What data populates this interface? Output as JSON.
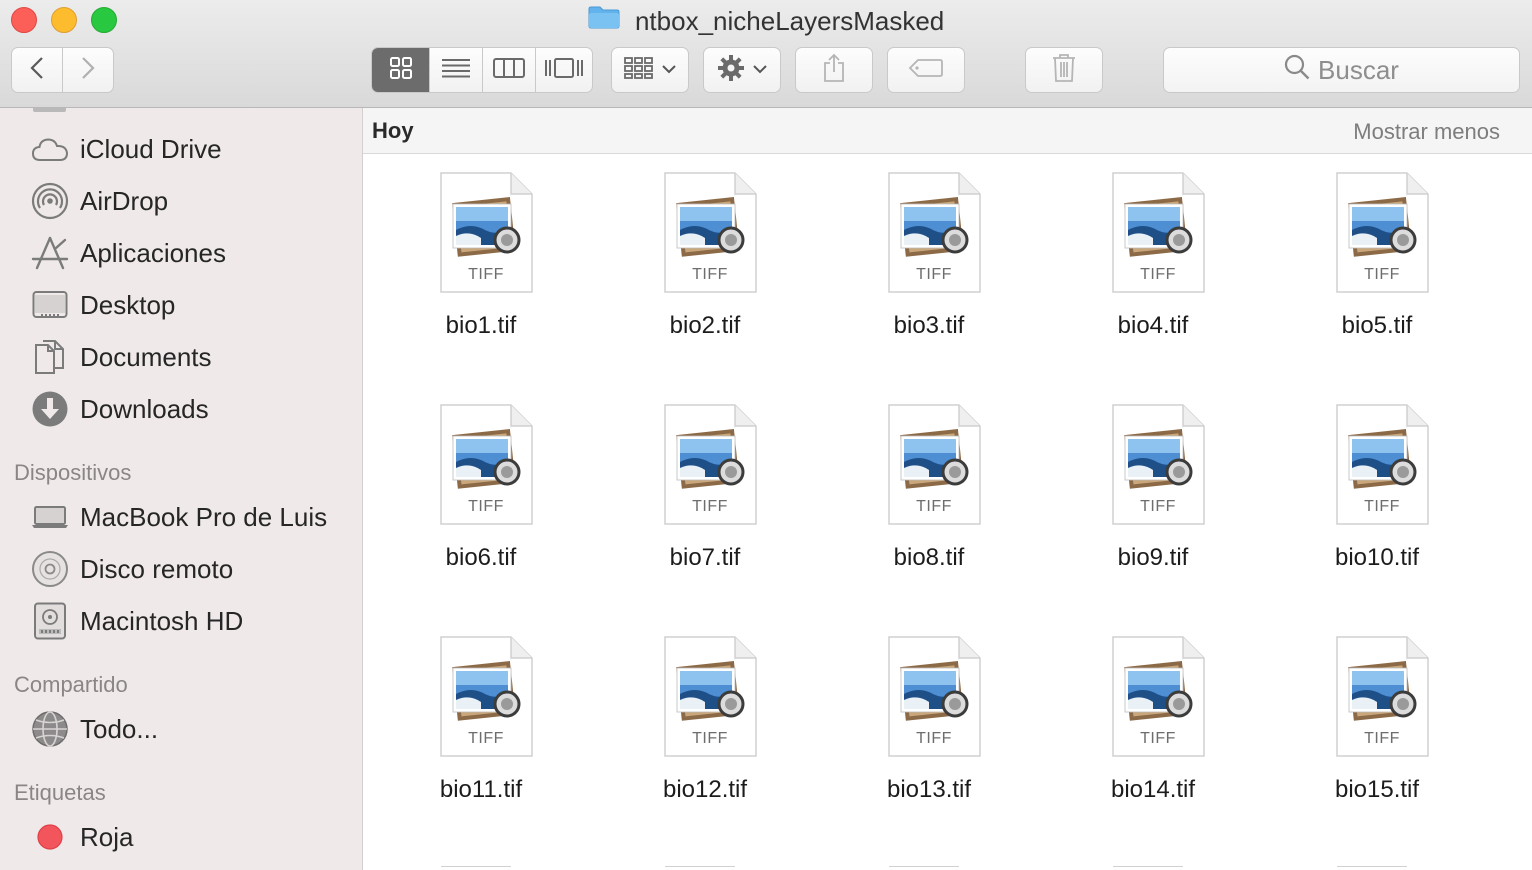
{
  "window": {
    "title": "ntbox_nicheLayersMasked"
  },
  "toolbar": {
    "search_placeholder": "Buscar",
    "icons": [
      "back-icon",
      "forward-icon",
      "icon-view-icon",
      "list-view-icon",
      "column-view-icon",
      "cover-flow-icon",
      "arrange-icon",
      "gear-icon",
      "share-icon",
      "tag-icon",
      "trash-icon",
      "search-icon"
    ]
  },
  "sidebar": {
    "favorites": [
      {
        "label": "iCloud Drive",
        "icon": "cloud-icon"
      },
      {
        "label": "AirDrop",
        "icon": "airdrop-icon"
      },
      {
        "label": "Aplicaciones",
        "icon": "applications-icon"
      },
      {
        "label": "Desktop",
        "icon": "desktop-icon"
      },
      {
        "label": "Documents",
        "icon": "documents-icon"
      },
      {
        "label": "Downloads",
        "icon": "downloads-icon"
      }
    ],
    "devices_heading": "Dispositivos",
    "devices": [
      {
        "label": "MacBook Pro de Luis",
        "icon": "laptop-icon"
      },
      {
        "label": "Disco remoto",
        "icon": "disc-icon"
      },
      {
        "label": "Macintosh HD",
        "icon": "hard-drive-icon"
      }
    ],
    "shared_heading": "Compartido",
    "shared": [
      {
        "label": "Todo...",
        "icon": "network-icon"
      }
    ],
    "tags_heading": "Etiquetas",
    "tags": [
      {
        "label": "Roja",
        "color": "#f2555b"
      }
    ]
  },
  "main": {
    "group_title": "Hoy",
    "group_toggle": "Mostrar menos",
    "file_kind": "TIFF",
    "files": [
      {
        "name": "bio1.tif"
      },
      {
        "name": "bio2.tif"
      },
      {
        "name": "bio3.tif"
      },
      {
        "name": "bio4.tif"
      },
      {
        "name": "bio5.tif"
      },
      {
        "name": "bio6.tif"
      },
      {
        "name": "bio7.tif"
      },
      {
        "name": "bio8.tif"
      },
      {
        "name": "bio9.tif"
      },
      {
        "name": "bio10.tif"
      },
      {
        "name": "bio11.tif"
      },
      {
        "name": "bio12.tif"
      },
      {
        "name": "bio13.tif"
      },
      {
        "name": "bio14.tif"
      },
      {
        "name": "bio15.tif"
      }
    ]
  },
  "colors": {
    "sidebar_bg": "#efeae9",
    "toolbar_bg": "#e3e3e3",
    "folder_blue": "#5fb2ec",
    "tag_red": "#f2555b"
  }
}
